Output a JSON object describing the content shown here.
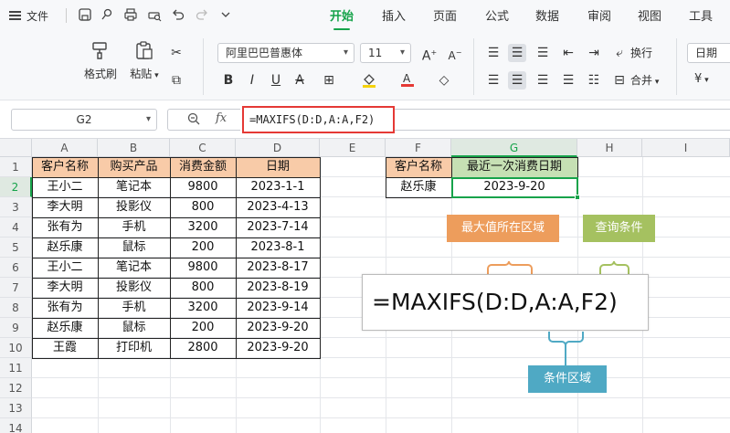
{
  "menu": {
    "file_label": "文件",
    "tabs": [
      {
        "label": "开始",
        "active": true
      },
      {
        "label": "插入",
        "active": false
      },
      {
        "label": "页面",
        "active": false
      },
      {
        "label": "公式",
        "active": false
      },
      {
        "label": "数据",
        "active": false
      },
      {
        "label": "审阅",
        "active": false
      },
      {
        "label": "视图",
        "active": false
      },
      {
        "label": "工具",
        "active": false
      }
    ],
    "quick_icons": [
      "save-icon",
      "pin-icon",
      "print-icon",
      "print-preview-icon",
      "undo-icon",
      "redo-icon",
      "more-icon"
    ]
  },
  "ribbon": {
    "format_painter_label": "格式刷",
    "paste_label": "粘贴",
    "font_name": "阿里巴巴普惠体",
    "font_size": "11",
    "wrap_label": "换行",
    "merge_label": "合并",
    "number_format": "日期",
    "currency_symbol": "¥"
  },
  "formula_bar": {
    "cell_ref": "G2",
    "fx_label": "fx",
    "formula": "=MAXIFS(D:D,A:A,F2)"
  },
  "grid": {
    "columns": [
      "A",
      "B",
      "C",
      "D",
      "E",
      "F",
      "G",
      "H",
      "I"
    ],
    "active_column": "G",
    "rows": [
      "1",
      "2",
      "3",
      "4",
      "5",
      "6",
      "7",
      "8",
      "9",
      "10",
      "11",
      "12",
      "13",
      "14"
    ],
    "active_row": "2"
  },
  "table": {
    "headers": [
      "客户名称",
      "购买产品",
      "消费金额",
      "日期"
    ],
    "rows": [
      [
        "王小二",
        "笔记本",
        "9800",
        "2023-1-1"
      ],
      [
        "李大明",
        "投影仪",
        "800",
        "2023-4-13"
      ],
      [
        "张有为",
        "手机",
        "3200",
        "2023-7-14"
      ],
      [
        "赵乐康",
        "鼠标",
        "200",
        "2023-8-1"
      ],
      [
        "王小二",
        "笔记本",
        "9800",
        "2023-8-17"
      ],
      [
        "李大明",
        "投影仪",
        "800",
        "2023-8-19"
      ],
      [
        "张有为",
        "手机",
        "3200",
        "2023-9-14"
      ],
      [
        "赵乐康",
        "鼠标",
        "200",
        "2023-9-20"
      ],
      [
        "王霞",
        "打印机",
        "2800",
        "2023-9-20"
      ]
    ]
  },
  "lookup": {
    "header_customer": "客户名称",
    "header_result": "最近一次消费日期",
    "customer": "赵乐康",
    "result": "2023-9-20"
  },
  "annotation": {
    "formula": "=MAXIFS(D:D,A:A,F2)",
    "max_range_label": "最大值所在区域",
    "criteria_label": "查询条件",
    "criteria_range_label": "条件区域"
  },
  "colors": {
    "accent": "#16a34a",
    "header_orange": "#f8cba8",
    "header_green": "#c6e0b4",
    "callout_orange": "#ed9d5c",
    "callout_green": "#a5c160",
    "callout_blue": "#4fa9c4",
    "highlight_red": "#e53935"
  }
}
